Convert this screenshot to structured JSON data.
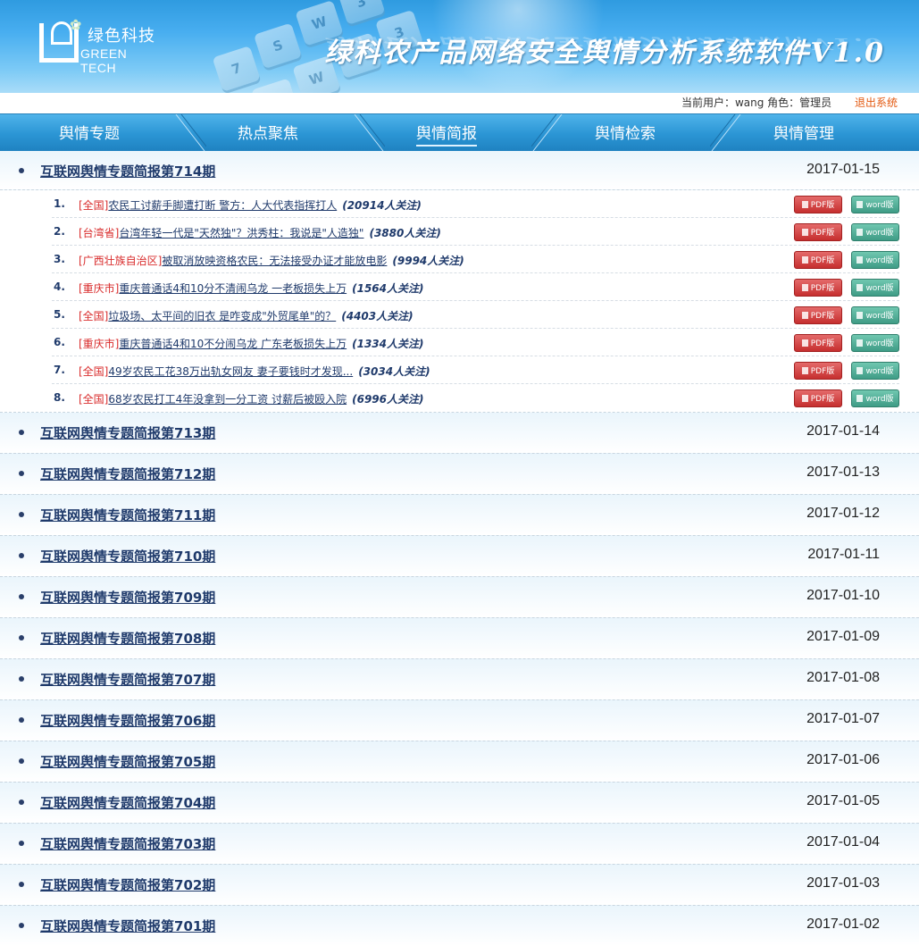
{
  "header": {
    "logo_cn": "绿色科技",
    "logo_en": "GREEN TECH",
    "title": "绿科农产品网络安全舆情分析系统软件V1.0"
  },
  "userbar": {
    "current_user": "当前用户：wang 角色：管理员",
    "logout": "退出系统"
  },
  "nav": {
    "items": [
      {
        "label": "舆情专题"
      },
      {
        "label": "热点聚焦"
      },
      {
        "label": "舆情简报"
      },
      {
        "label": "舆情检索"
      },
      {
        "label": "舆情管理"
      }
    ],
    "active_index": 2
  },
  "buttons": {
    "pdf": "PDF版",
    "word": "word版"
  },
  "expanded_issue": {
    "title": "互联网舆情专题简报第714期",
    "date": "2017-01-15",
    "articles": [
      {
        "num": "1.",
        "region": "[全国]",
        "headline": "农民工讨薪手脚遭打断 警方：人大代表指挥打人",
        "count": "(20914人关注)"
      },
      {
        "num": "2.",
        "region": "[台湾省]",
        "headline": "台湾年轻一代是\"天然独\"？洪秀柱：我说是\"人造独\"",
        "count": "(3880人关注)"
      },
      {
        "num": "3.",
        "region": "[广西壮族自治区]",
        "headline": "被取消放映资格农民：无法接受办证才能放电影",
        "count": "(9994人关注)"
      },
      {
        "num": "4.",
        "region": "[重庆市]",
        "headline": "重庆普通话4和10分不清闹乌龙 一老板损失上万",
        "count": "(1564人关注)"
      },
      {
        "num": "5.",
        "region": "[全国]",
        "headline": "垃圾场、太平间的旧衣 是咋变成\"外贸尾单\"的？",
        "count": "(4403人关注)"
      },
      {
        "num": "6.",
        "region": "[重庆市]",
        "headline": "重庆普通话4和10不分闹乌龙 广东老板损失上万",
        "count": "(1334人关注)"
      },
      {
        "num": "7.",
        "region": "[全国]",
        "headline": "49岁农民工花38万出轨女网友 妻子要钱时才发现...",
        "count": "(3034人关注)"
      },
      {
        "num": "8.",
        "region": "[全国]",
        "headline": "68岁农民打工4年没拿到一分工资 讨薪后被殴入院",
        "count": "(6996人关注)"
      }
    ]
  },
  "issues": [
    {
      "title": "互联网舆情专题简报第713期",
      "date": "2017-01-14"
    },
    {
      "title": "互联网舆情专题简报第712期",
      "date": "2017-01-13"
    },
    {
      "title": "互联网舆情专题简报第711期",
      "date": "2017-01-12"
    },
    {
      "title": "互联网舆情专题简报第710期",
      "date": "2017-01-11"
    },
    {
      "title": "互联网舆情专题简报第709期",
      "date": "2017-01-10"
    },
    {
      "title": "互联网舆情专题简报第708期",
      "date": "2017-01-09"
    },
    {
      "title": "互联网舆情专题简报第707期",
      "date": "2017-01-08"
    },
    {
      "title": "互联网舆情专题简报第706期",
      "date": "2017-01-07"
    },
    {
      "title": "互联网舆情专题简报第705期",
      "date": "2017-01-06"
    },
    {
      "title": "互联网舆情专题简报第704期",
      "date": "2017-01-05"
    },
    {
      "title": "互联网舆情专题简报第703期",
      "date": "2017-01-04"
    },
    {
      "title": "互联网舆情专题简报第702期",
      "date": "2017-01-03"
    },
    {
      "title": "互联网舆情专题简报第701期",
      "date": "2017-01-02"
    }
  ],
  "colors": {
    "nav": "#2b95d4",
    "region": "#d92c2c",
    "link": "#1f3a6b",
    "logout": "#e35a12",
    "pdf": "#c62f2f",
    "word": "#3f9c86"
  }
}
